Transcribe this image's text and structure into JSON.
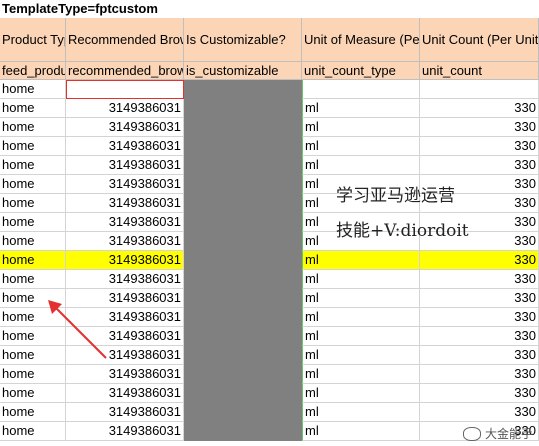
{
  "sheet": {
    "template_label": "TemplateType=fptcustom",
    "header_names": [
      "Product Type",
      "Recommended Browse Nodes",
      "Is Customizable?",
      "Unit of Measure (Per Unit Pricing)",
      "Unit Count (Per Unit Pricing)"
    ],
    "header_keys": [
      "feed_product_type",
      "recommended_browse_nodes",
      "is_customizable",
      "unit_count_type",
      "unit_count"
    ],
    "first_row": {
      "product_type": "home"
    },
    "rows": [
      {
        "product_type": "home",
        "browse_node": "3149386031",
        "unit": "ml",
        "count": "330"
      },
      {
        "product_type": "home",
        "browse_node": "3149386031",
        "unit": "ml",
        "count": "330"
      },
      {
        "product_type": "home",
        "browse_node": "3149386031",
        "unit": "ml",
        "count": "330"
      },
      {
        "product_type": "home",
        "browse_node": "3149386031",
        "unit": "ml",
        "count": "330"
      },
      {
        "product_type": "home",
        "browse_node": "3149386031",
        "unit": "ml",
        "count": "330"
      },
      {
        "product_type": "home",
        "browse_node": "3149386031",
        "unit": "ml",
        "count": "330"
      },
      {
        "product_type": "home",
        "browse_node": "3149386031",
        "unit": "ml",
        "count": "330"
      },
      {
        "product_type": "home",
        "browse_node": "3149386031",
        "unit": "ml",
        "count": "330"
      },
      {
        "product_type": "home",
        "browse_node": "3149386031",
        "unit": "ml",
        "count": "330",
        "highlight": true
      },
      {
        "product_type": "home",
        "browse_node": "3149386031",
        "unit": "ml",
        "count": "330"
      },
      {
        "product_type": "home",
        "browse_node": "3149386031",
        "unit": "ml",
        "count": "330"
      },
      {
        "product_type": "home",
        "browse_node": "3149386031",
        "unit": "ml",
        "count": "330"
      },
      {
        "product_type": "home",
        "browse_node": "3149386031",
        "unit": "ml",
        "count": "330"
      },
      {
        "product_type": "home",
        "browse_node": "3149386031",
        "unit": "ml",
        "count": "330"
      },
      {
        "product_type": "home",
        "browse_node": "3149386031",
        "unit": "ml",
        "count": "330"
      },
      {
        "product_type": "home",
        "browse_node": "3149386031",
        "unit": "ml",
        "count": "330"
      },
      {
        "product_type": "home",
        "browse_node": "3149386031",
        "unit": "ml",
        "count": "330"
      },
      {
        "product_type": "home",
        "browse_node": "3149386031",
        "unit": "ml",
        "count": "330"
      }
    ]
  },
  "overlay": {
    "line1": "学习亚马逊运营",
    "line2": "技能+V:diordoit",
    "watermark": "大金能手"
  },
  "colors": {
    "header_bg": "#fbd5b5",
    "grey_column": "#808080",
    "highlight": "#ffff00",
    "arrow": "#e53030"
  }
}
